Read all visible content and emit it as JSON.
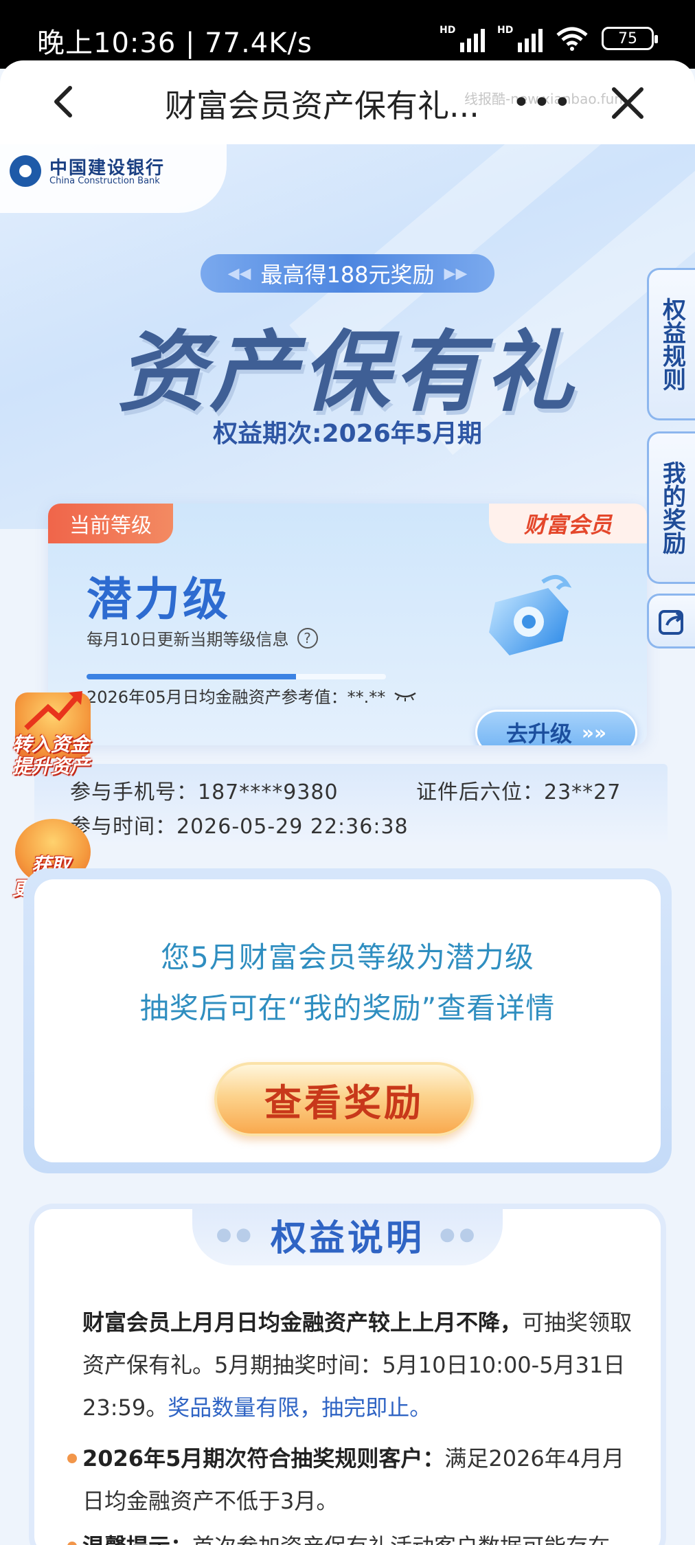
{
  "status_bar": {
    "time_speed": "晚上10:36 | 77.4K/s",
    "battery": "75",
    "hd1": "HD",
    "hd2": "HD"
  },
  "nav": {
    "title": "财富会员资产保有礼...",
    "more": "•••",
    "watermark": "线报酷-new.xianbao.fun"
  },
  "brand": {
    "name_cn": "中国建设银行",
    "name_en": "China Construction Bank",
    "color": "#1e5aa8"
  },
  "hero": {
    "reward_pill": "最高得188元奖励",
    "title": "资产保有礼",
    "period": "权益期次:2026年5月期"
  },
  "level_card": {
    "tag": "当前等级",
    "wealth_tag": "财富会员",
    "level": "潜力级",
    "update_note": "每月10日更新当期等级信息",
    "asset_ref": "2026年05月日均金融资产参考值：**.**",
    "progress": 0.7,
    "upgrade": "去升级",
    "upgrade_arrows": "»»"
  },
  "participant": {
    "phone": "参与手机号：187****9380",
    "id_suffix": "证件后六位：23**27",
    "time": "参与时间：2026-05-29 22:36:38"
  },
  "float_badges": {
    "transfer_line1": "转入资金",
    "transfer_line2": "提升资产",
    "more_line1": "获取",
    "more_line2": "更多奖励"
  },
  "side_tabs": {
    "rules": "权益规则",
    "my_rewards": "我的奖励"
  },
  "result": {
    "line1": "您5月财富会员等级为潜力级",
    "line2": "抽奖后可在“我的奖励”查看详情",
    "button": "查看奖励"
  },
  "rights": {
    "title": "权益说明",
    "p1_bold": "财富会员上月月日均金融资产较上上月不降，",
    "p1_rest": "可抽奖领取资产保有礼。5月期抽奖时间：5月10日10:00-5月31日23:59。",
    "p1_blue": "奖品数量有限，抽完即止。",
    "p2_bold": "2026年5月期次符合抽奖规则客户：",
    "p2_rest": "满足2026年4月月日均金融资产不低于3月。",
    "p3_bold": "温馨提示：",
    "p3_rest": "首次参加资产保有礼活动客户数据可能存在"
  }
}
